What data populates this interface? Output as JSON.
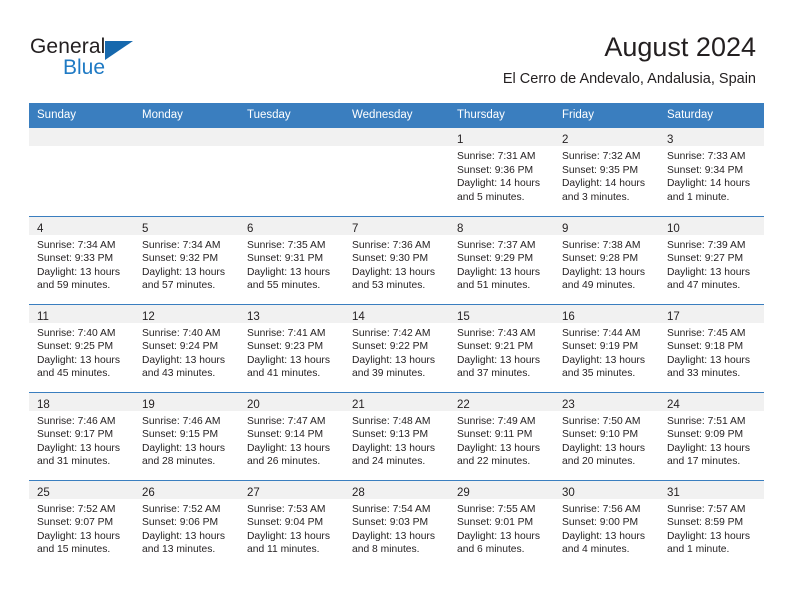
{
  "brand": {
    "name_part1": "General",
    "name_part2": "Blue",
    "accent_color": "#1f7ac4",
    "triangle_color": "#1668ad"
  },
  "header": {
    "title": "August 2024",
    "subtitle": "El Cerro de Andevalo, Andalusia, Spain"
  },
  "theme": {
    "header_row_bg": "#3a7ebf",
    "daynum_band_bg": "#f1f1f1",
    "text_color": "#231f20"
  },
  "weekday_headers": [
    "Sunday",
    "Monday",
    "Tuesday",
    "Wednesday",
    "Thursday",
    "Friday",
    "Saturday"
  ],
  "weeks": [
    [
      {
        "day": "",
        "sunrise": "",
        "sunset": "",
        "daylight1": "",
        "daylight2": ""
      },
      {
        "day": "",
        "sunrise": "",
        "sunset": "",
        "daylight1": "",
        "daylight2": ""
      },
      {
        "day": "",
        "sunrise": "",
        "sunset": "",
        "daylight1": "",
        "daylight2": ""
      },
      {
        "day": "",
        "sunrise": "",
        "sunset": "",
        "daylight1": "",
        "daylight2": ""
      },
      {
        "day": "1",
        "sunrise": "Sunrise: 7:31 AM",
        "sunset": "Sunset: 9:36 PM",
        "daylight1": "Daylight: 14 hours",
        "daylight2": "and 5 minutes."
      },
      {
        "day": "2",
        "sunrise": "Sunrise: 7:32 AM",
        "sunset": "Sunset: 9:35 PM",
        "daylight1": "Daylight: 14 hours",
        "daylight2": "and 3 minutes."
      },
      {
        "day": "3",
        "sunrise": "Sunrise: 7:33 AM",
        "sunset": "Sunset: 9:34 PM",
        "daylight1": "Daylight: 14 hours",
        "daylight2": "and 1 minute."
      }
    ],
    [
      {
        "day": "4",
        "sunrise": "Sunrise: 7:34 AM",
        "sunset": "Sunset: 9:33 PM",
        "daylight1": "Daylight: 13 hours",
        "daylight2": "and 59 minutes."
      },
      {
        "day": "5",
        "sunrise": "Sunrise: 7:34 AM",
        "sunset": "Sunset: 9:32 PM",
        "daylight1": "Daylight: 13 hours",
        "daylight2": "and 57 minutes."
      },
      {
        "day": "6",
        "sunrise": "Sunrise: 7:35 AM",
        "sunset": "Sunset: 9:31 PM",
        "daylight1": "Daylight: 13 hours",
        "daylight2": "and 55 minutes."
      },
      {
        "day": "7",
        "sunrise": "Sunrise: 7:36 AM",
        "sunset": "Sunset: 9:30 PM",
        "daylight1": "Daylight: 13 hours",
        "daylight2": "and 53 minutes."
      },
      {
        "day": "8",
        "sunrise": "Sunrise: 7:37 AM",
        "sunset": "Sunset: 9:29 PM",
        "daylight1": "Daylight: 13 hours",
        "daylight2": "and 51 minutes."
      },
      {
        "day": "9",
        "sunrise": "Sunrise: 7:38 AM",
        "sunset": "Sunset: 9:28 PM",
        "daylight1": "Daylight: 13 hours",
        "daylight2": "and 49 minutes."
      },
      {
        "day": "10",
        "sunrise": "Sunrise: 7:39 AM",
        "sunset": "Sunset: 9:27 PM",
        "daylight1": "Daylight: 13 hours",
        "daylight2": "and 47 minutes."
      }
    ],
    [
      {
        "day": "11",
        "sunrise": "Sunrise: 7:40 AM",
        "sunset": "Sunset: 9:25 PM",
        "daylight1": "Daylight: 13 hours",
        "daylight2": "and 45 minutes."
      },
      {
        "day": "12",
        "sunrise": "Sunrise: 7:40 AM",
        "sunset": "Sunset: 9:24 PM",
        "daylight1": "Daylight: 13 hours",
        "daylight2": "and 43 minutes."
      },
      {
        "day": "13",
        "sunrise": "Sunrise: 7:41 AM",
        "sunset": "Sunset: 9:23 PM",
        "daylight1": "Daylight: 13 hours",
        "daylight2": "and 41 minutes."
      },
      {
        "day": "14",
        "sunrise": "Sunrise: 7:42 AM",
        "sunset": "Sunset: 9:22 PM",
        "daylight1": "Daylight: 13 hours",
        "daylight2": "and 39 minutes."
      },
      {
        "day": "15",
        "sunrise": "Sunrise: 7:43 AM",
        "sunset": "Sunset: 9:21 PM",
        "daylight1": "Daylight: 13 hours",
        "daylight2": "and 37 minutes."
      },
      {
        "day": "16",
        "sunrise": "Sunrise: 7:44 AM",
        "sunset": "Sunset: 9:19 PM",
        "daylight1": "Daylight: 13 hours",
        "daylight2": "and 35 minutes."
      },
      {
        "day": "17",
        "sunrise": "Sunrise: 7:45 AM",
        "sunset": "Sunset: 9:18 PM",
        "daylight1": "Daylight: 13 hours",
        "daylight2": "and 33 minutes."
      }
    ],
    [
      {
        "day": "18",
        "sunrise": "Sunrise: 7:46 AM",
        "sunset": "Sunset: 9:17 PM",
        "daylight1": "Daylight: 13 hours",
        "daylight2": "and 31 minutes."
      },
      {
        "day": "19",
        "sunrise": "Sunrise: 7:46 AM",
        "sunset": "Sunset: 9:15 PM",
        "daylight1": "Daylight: 13 hours",
        "daylight2": "and 28 minutes."
      },
      {
        "day": "20",
        "sunrise": "Sunrise: 7:47 AM",
        "sunset": "Sunset: 9:14 PM",
        "daylight1": "Daylight: 13 hours",
        "daylight2": "and 26 minutes."
      },
      {
        "day": "21",
        "sunrise": "Sunrise: 7:48 AM",
        "sunset": "Sunset: 9:13 PM",
        "daylight1": "Daylight: 13 hours",
        "daylight2": "and 24 minutes."
      },
      {
        "day": "22",
        "sunrise": "Sunrise: 7:49 AM",
        "sunset": "Sunset: 9:11 PM",
        "daylight1": "Daylight: 13 hours",
        "daylight2": "and 22 minutes."
      },
      {
        "day": "23",
        "sunrise": "Sunrise: 7:50 AM",
        "sunset": "Sunset: 9:10 PM",
        "daylight1": "Daylight: 13 hours",
        "daylight2": "and 20 minutes."
      },
      {
        "day": "24",
        "sunrise": "Sunrise: 7:51 AM",
        "sunset": "Sunset: 9:09 PM",
        "daylight1": "Daylight: 13 hours",
        "daylight2": "and 17 minutes."
      }
    ],
    [
      {
        "day": "25",
        "sunrise": "Sunrise: 7:52 AM",
        "sunset": "Sunset: 9:07 PM",
        "daylight1": "Daylight: 13 hours",
        "daylight2": "and 15 minutes."
      },
      {
        "day": "26",
        "sunrise": "Sunrise: 7:52 AM",
        "sunset": "Sunset: 9:06 PM",
        "daylight1": "Daylight: 13 hours",
        "daylight2": "and 13 minutes."
      },
      {
        "day": "27",
        "sunrise": "Sunrise: 7:53 AM",
        "sunset": "Sunset: 9:04 PM",
        "daylight1": "Daylight: 13 hours",
        "daylight2": "and 11 minutes."
      },
      {
        "day": "28",
        "sunrise": "Sunrise: 7:54 AM",
        "sunset": "Sunset: 9:03 PM",
        "daylight1": "Daylight: 13 hours",
        "daylight2": "and 8 minutes."
      },
      {
        "day": "29",
        "sunrise": "Sunrise: 7:55 AM",
        "sunset": "Sunset: 9:01 PM",
        "daylight1": "Daylight: 13 hours",
        "daylight2": "and 6 minutes."
      },
      {
        "day": "30",
        "sunrise": "Sunrise: 7:56 AM",
        "sunset": "Sunset: 9:00 PM",
        "daylight1": "Daylight: 13 hours",
        "daylight2": "and 4 minutes."
      },
      {
        "day": "31",
        "sunrise": "Sunrise: 7:57 AM",
        "sunset": "Sunset: 8:59 PM",
        "daylight1": "Daylight: 13 hours",
        "daylight2": "and 1 minute."
      }
    ]
  ]
}
